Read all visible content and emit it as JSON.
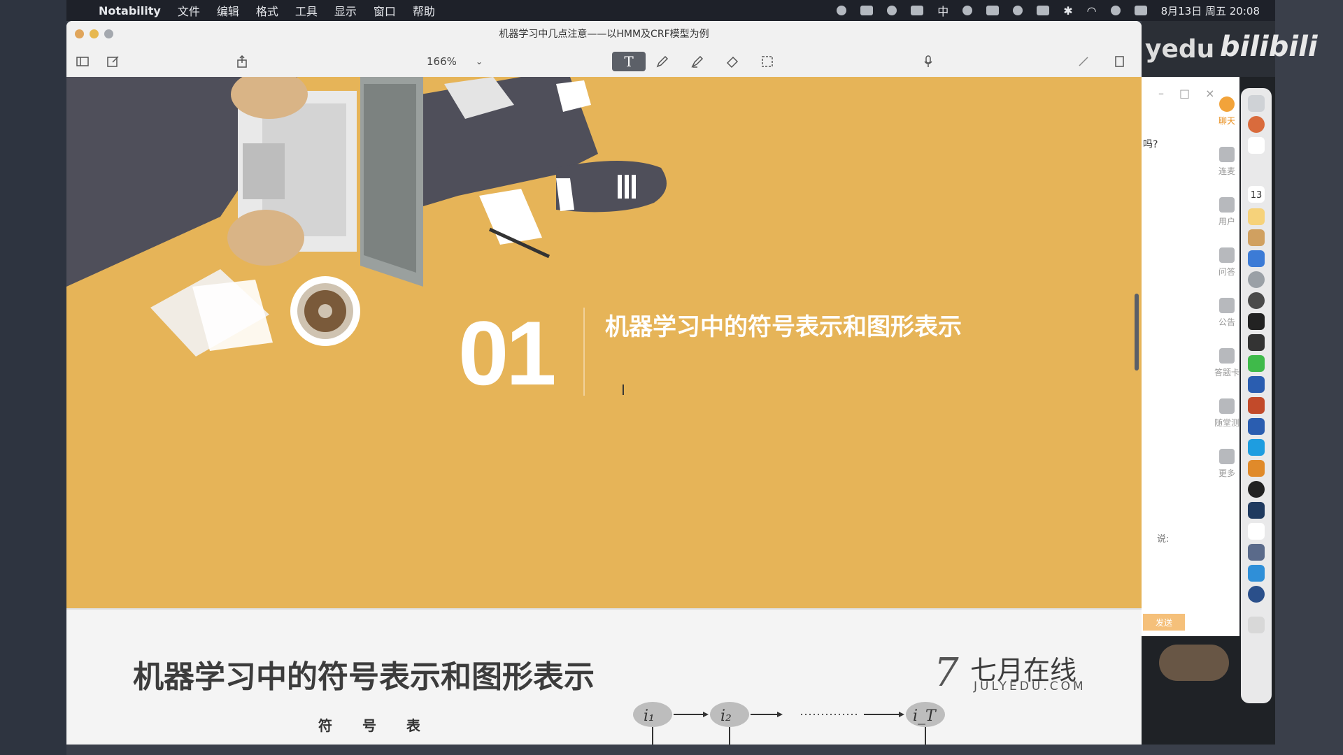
{
  "menubar": {
    "apple_glyph": "",
    "app_name": "Notability",
    "menus": [
      "文件",
      "编辑",
      "格式",
      "工具",
      "显示",
      "窗口",
      "帮助"
    ],
    "ime_label": "中",
    "clock": "8月13日 周五 20:08"
  },
  "window": {
    "title": "机器学习中几点注意——以HMM及CRF模型为例",
    "zoom": "166%",
    "tools": [
      "text-tool",
      "pencil-tool",
      "highlighter-tool",
      "eraser-tool",
      "lasso-tool"
    ],
    "active_tool_glyph": "T"
  },
  "slide1": {
    "section_number": "01",
    "section_title": "机器学习中的符号表示和图形表示"
  },
  "slide2": {
    "title": "机器学习中的符号表示和图形表示",
    "logo_cn": "七月在线",
    "logo_en": "JULYEDU.COM",
    "symbol_table_label": "符 号 表",
    "hmm_nodes": [
      "i₁",
      "i₂",
      "i_T"
    ]
  },
  "right_panel": {
    "brand_text": "yedu",
    "bilibili": "bilibili",
    "question_snippet": "吗?",
    "nav": [
      {
        "label": "聊天",
        "icon": "chat-icon",
        "active": true
      },
      {
        "label": "连麦",
        "icon": "phone-icon",
        "active": false
      },
      {
        "label": "用户",
        "icon": "user-icon",
        "active": false
      },
      {
        "label": "问答",
        "icon": "question-icon",
        "active": false
      },
      {
        "label": "公告",
        "icon": "notice-icon",
        "active": false
      },
      {
        "label": "答题卡",
        "icon": "answer-card-icon",
        "active": false
      },
      {
        "label": "随堂测",
        "icon": "quiz-icon",
        "active": false
      },
      {
        "label": "更多",
        "icon": "more-icon",
        "active": false
      }
    ],
    "say_placeholder": "说:",
    "send_label": "发送",
    "dock_calendar_day": "13"
  },
  "colors": {
    "slide_bg": "#e6b458",
    "slide_text": "#ffffff",
    "accent_orange": "#f2a33a"
  }
}
